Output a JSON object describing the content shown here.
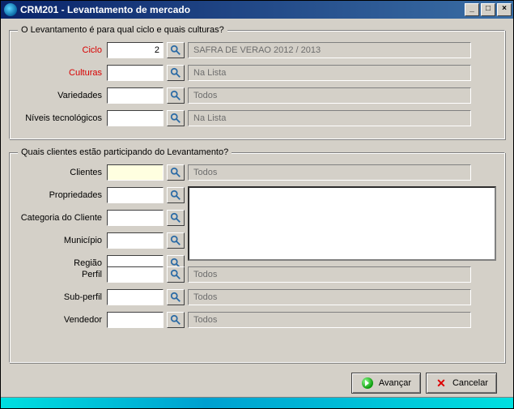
{
  "window": {
    "title": "CRM201 - Levantamento de mercado",
    "buttons": {
      "minimize": "_",
      "maximize": "□",
      "close": "×"
    }
  },
  "group1": {
    "legend": "O Levantamento é para qual ciclo e quais culturas?",
    "ciclo": {
      "label": "Ciclo",
      "value": "2",
      "readout": "SAFRA DE VERAO 2012 / 2013"
    },
    "culturas": {
      "label": "Culturas",
      "value": "",
      "readout": "Na Lista"
    },
    "variedades": {
      "label": "Variedades",
      "value": "",
      "readout": "Todos"
    },
    "niveis": {
      "label": "Níveis tecnológicos",
      "value": "",
      "readout": "Na Lista"
    }
  },
  "group2": {
    "legend": "Quais clientes estão participando do Levantamento?",
    "clientes": {
      "label": "Clientes",
      "value": "",
      "readout": "Todos"
    },
    "propriedades": {
      "label": "Propriedades",
      "value": ""
    },
    "categoria": {
      "label": "Categoria do Cliente",
      "value": ""
    },
    "municipio": {
      "label": "Município",
      "value": ""
    },
    "regiao": {
      "label": "Região",
      "value": ""
    },
    "perfil": {
      "label": "Perfil",
      "value": "",
      "readout": "Todos"
    },
    "subperfil": {
      "label": "Sub-perfil",
      "value": "",
      "readout": "Todos"
    },
    "vendedor": {
      "label": "Vendedor",
      "value": "",
      "readout": "Todos"
    }
  },
  "buttons": {
    "avancar": "Avançar",
    "cancelar": "Cancelar"
  }
}
